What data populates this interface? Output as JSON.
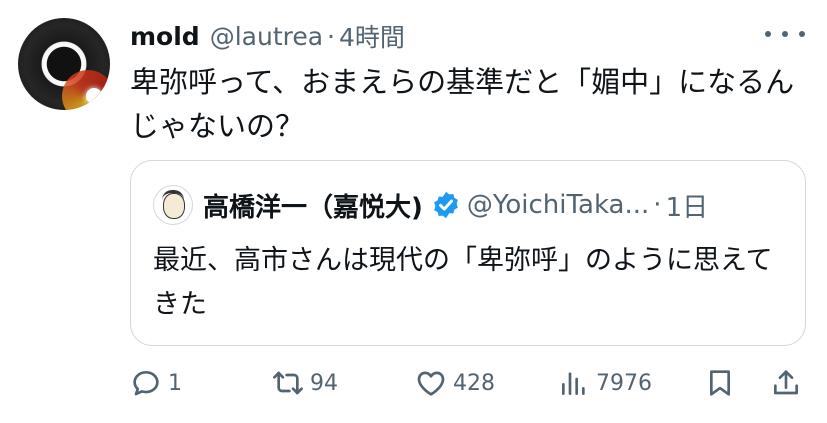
{
  "tweet": {
    "author_name": "mold",
    "author_handle": "@lautrea",
    "separator": "·",
    "time": "4時間",
    "text": "卑弥呼って、おまえらの基準だと「媚中」になるんじゃないの？"
  },
  "quote": {
    "author_name": "高橋洋一（嘉悦大)",
    "author_handle": "@YoichiTaka...",
    "separator": "·",
    "time": "1日",
    "text": "最近、高市さんは現代の「卑弥呼」のように思えてきた",
    "verified_color": "#1d9bf0"
  },
  "actions": {
    "reply_count": "1",
    "retweet_count": "94",
    "like_count": "428",
    "views_count": "7976"
  },
  "icons": {
    "more": "more-icon",
    "reply": "reply-icon",
    "retweet": "retweet-icon",
    "like": "heart-icon",
    "views": "views-icon",
    "bookmark": "bookmark-icon",
    "share": "share-icon",
    "verified": "verified-badge-icon"
  },
  "colors": {
    "text": "#0f1419",
    "secondary": "#536471",
    "border": "#cfd9de",
    "verified": "#1d9bf0"
  }
}
